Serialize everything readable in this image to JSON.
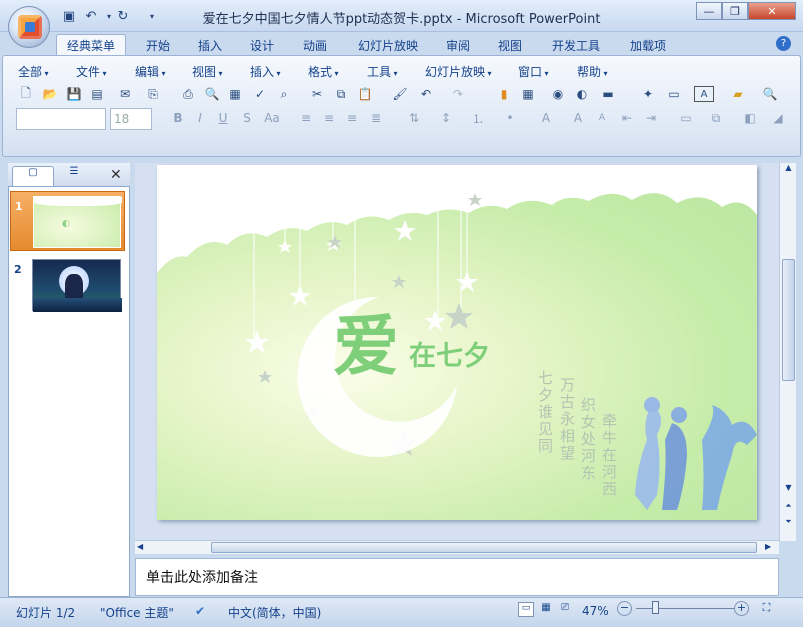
{
  "window": {
    "title": "爱在七夕中国七夕情人节ppt动态贺卡.pptx - Microsoft PowerPoint"
  },
  "ribbon": {
    "tabs": [
      "经典菜单",
      "开始",
      "插入",
      "设计",
      "动画",
      "幻灯片放映",
      "审阅",
      "视图",
      "开发工具",
      "加载项"
    ],
    "menus": [
      "全部",
      "文件",
      "编辑",
      "视图",
      "插入",
      "格式",
      "工具",
      "幻灯片放映",
      "窗口",
      "帮助"
    ],
    "font_size": "18"
  },
  "slide": {
    "title_big": "爱",
    "title_rest": "在七夕",
    "poem_cols": [
      "七夕谁见同",
      "万古永相望",
      "织女处河东",
      "牵牛在河西"
    ]
  },
  "slides_panel": {
    "numbers": [
      "1",
      "2"
    ]
  },
  "notes": {
    "placeholder": "单击此处添加备注"
  },
  "status": {
    "slide": "幻灯片 1/2",
    "theme": "\"Office 主题\"",
    "language": "中文(简体，中国)",
    "zoom": "47%"
  },
  "colors": {
    "accent": "#15428b",
    "active_thumb": "#f0a050",
    "title_green": "#7fcf7a"
  }
}
